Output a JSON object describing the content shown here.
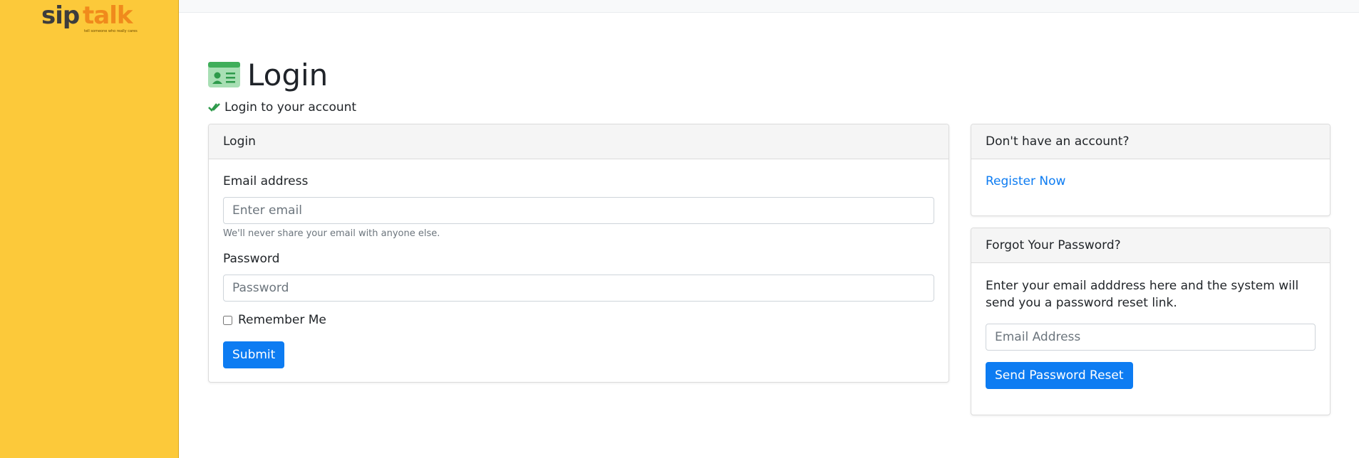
{
  "brand": {
    "name_part1": "sip",
    "name_part2": "talk",
    "tagline": "tell someone who really cares",
    "colors": {
      "sidebar": "#fcc93a",
      "accent": "#f08a1c",
      "primary": "#0d7cf2"
    }
  },
  "page": {
    "title": "Login",
    "title_icon": "id-card-icon",
    "subtitle": "Login to your account",
    "subtitle_icon": "double-check-icon"
  },
  "login_card": {
    "header": "Login",
    "email_label": "Email address",
    "email_placeholder": "Enter email",
    "email_value": "",
    "email_help": "We'll never share your email with anyone else.",
    "password_label": "Password",
    "password_placeholder": "Password",
    "password_value": "",
    "remember_label": "Remember Me",
    "remember_checked": false,
    "submit_label": "Submit"
  },
  "register_card": {
    "header": "Don't have an account?",
    "link_label": "Register Now"
  },
  "forgot_card": {
    "header": "Forgot Your Password?",
    "description": "Enter your email adddress here and the system will send you a password reset link.",
    "email_placeholder": "Email Address",
    "email_value": "",
    "button_label": "Send Password Reset"
  }
}
